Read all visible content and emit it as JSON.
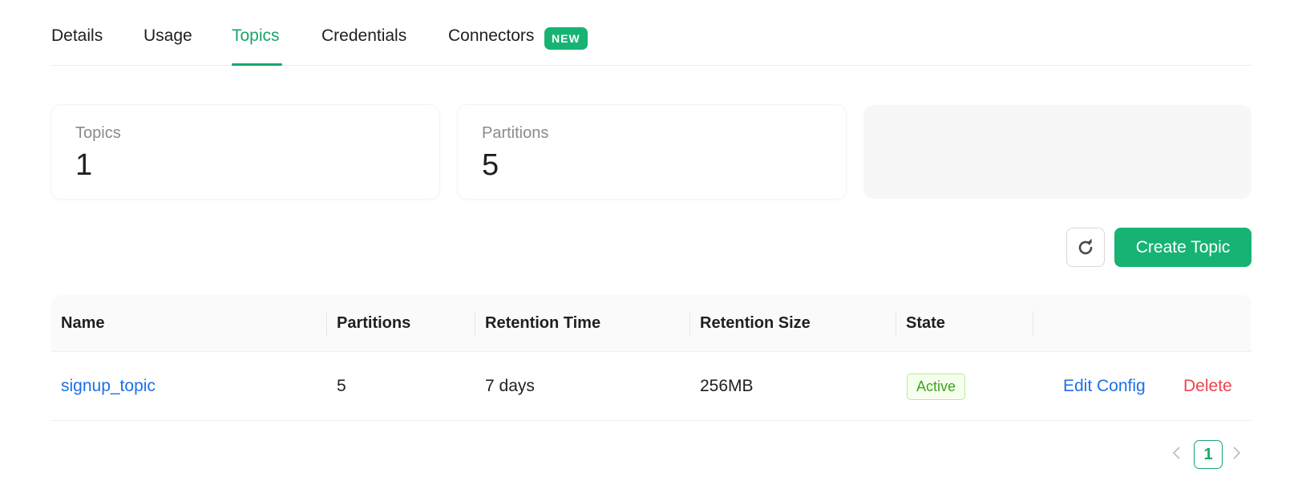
{
  "tabs": [
    {
      "label": "Details"
    },
    {
      "label": "Usage"
    },
    {
      "label": "Topics"
    },
    {
      "label": "Credentials"
    },
    {
      "label": "Connectors"
    }
  ],
  "active_tab": "Topics",
  "connectors_badge": "NEW",
  "stats": {
    "topics": {
      "label": "Topics",
      "value": "1"
    },
    "partitions": {
      "label": "Partitions",
      "value": "5"
    }
  },
  "toolbar": {
    "refresh_icon": "refresh-icon",
    "create_label": "Create Topic"
  },
  "table": {
    "columns": [
      "Name",
      "Partitions",
      "Retention Time",
      "Retention Size",
      "State",
      ""
    ],
    "rows": [
      {
        "name": "signup_topic",
        "partitions": "5",
        "retention_time": "7 days",
        "retention_size": "256MB",
        "state": "Active",
        "actions": {
          "edit": "Edit Config",
          "delete": "Delete"
        }
      }
    ]
  },
  "pagination": {
    "current_page": "1",
    "prev_icon": "chevron-left-icon",
    "next_icon": "chevron-right-icon"
  },
  "colors": {
    "accent": "#17b373",
    "link": "#1d6fe8",
    "danger": "#f0424a",
    "success_text": "#3aa51a"
  }
}
